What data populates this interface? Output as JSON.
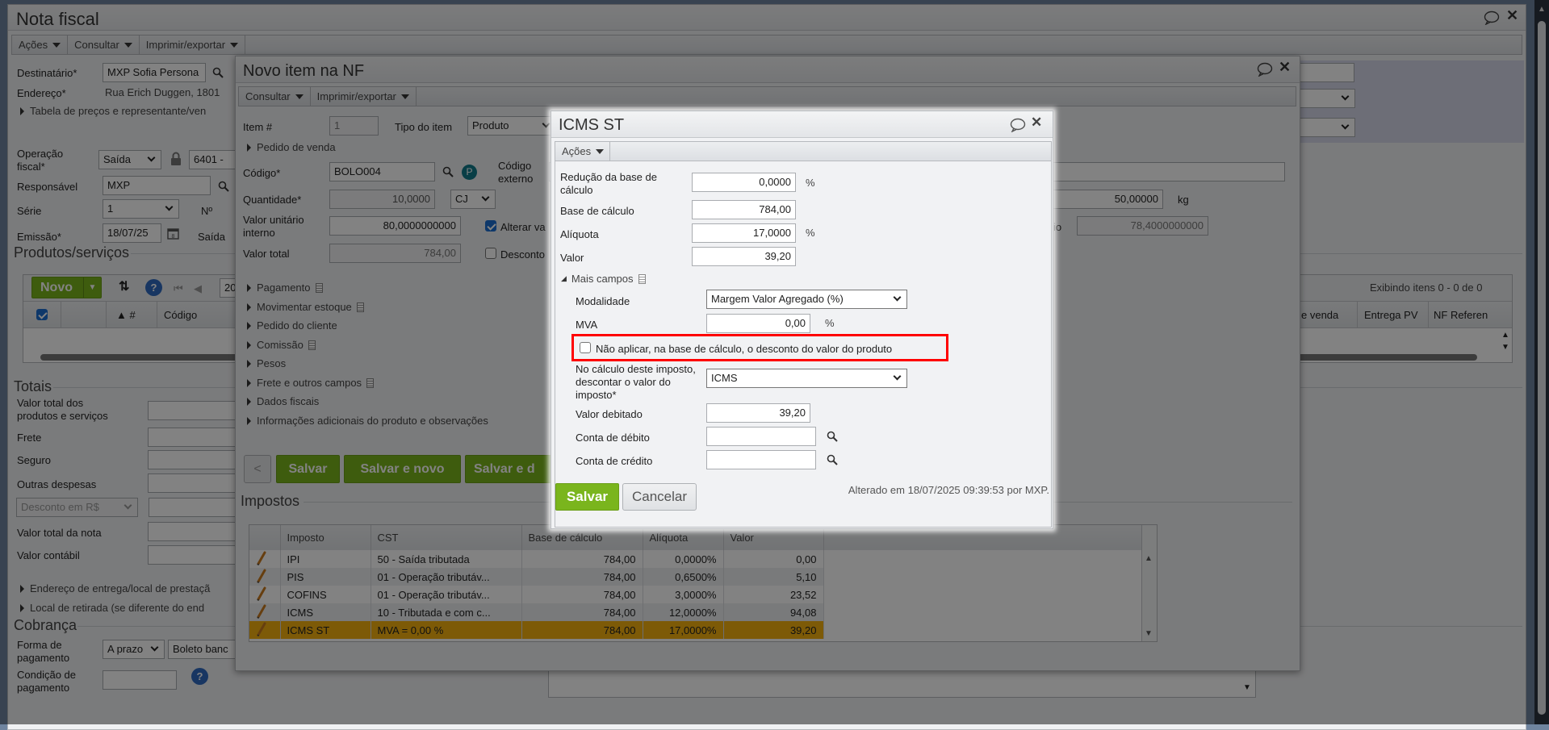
{
  "outer": {
    "title": "Nota fiscal",
    "menus": [
      "Ações",
      "Consultar",
      "Imprimir/exportar"
    ],
    "destinatario": {
      "label": "Destinatário*",
      "value": "MXP Sofia Persona"
    },
    "endereco": {
      "label": "Endereço*",
      "value": "Rua Erich Duggen, 1801"
    },
    "tabela_precos": "Tabela de preços e representante/ven",
    "operacao": {
      "label": "Operação fiscal*",
      "value": "Saída",
      "cfop": "6401 - "
    },
    "responsavel": {
      "label": "Responsável",
      "value": "MXP"
    },
    "serie": {
      "label": "Série",
      "value": "1"
    },
    "numero_label": "Nº",
    "emissao": {
      "label": "Emissão*",
      "value": "18/07/25"
    },
    "saida_label": "Saída",
    "produtos_title": "Produtos/serviços",
    "grid": {
      "novo": "Novo",
      "page": "20",
      "status": "Exibindo itens 0 - 0 de 0",
      "col_num": "▲ #",
      "col_codigo": "Código",
      "col_venda": "e venda",
      "col_entrega": "Entrega PV",
      "col_nf": "NF Referen"
    },
    "totais": {
      "title": "Totais",
      "fields": [
        "Valor total dos produtos e serviços",
        "Frete",
        "Seguro",
        "Outras despesas",
        "",
        "Valor total da nota",
        "Valor contábil"
      ],
      "desconto_select": "Desconto em R$"
    },
    "endereco_entrega": "Endereço de entrega/local de prestaçã",
    "local_retirada": "Local de retirada (se diferente do end",
    "cobranca": {
      "title": "Cobrança",
      "forma_label": "Forma de pagamento",
      "forma_value": "A prazo",
      "forma_tipo": "Boleto banc",
      "condicao_label": "Condição de pagamento"
    }
  },
  "item_window": {
    "title": "Novo item na NF",
    "menus": [
      "Consultar",
      "Imprimir/exportar"
    ],
    "item": {
      "label": "Item #",
      "value": "1"
    },
    "tipo": {
      "label": "Tipo do item",
      "value": "Produto"
    },
    "pedido_venda": "Pedido de venda",
    "codigo": {
      "label": "Código*",
      "value": "BOLO004"
    },
    "codigo_externo_label": "Código externo",
    "quantidade": {
      "label": "Quantidade*",
      "value": "10,0000",
      "unit": "CJ"
    },
    "valor_unitario": {
      "label": "Valor unitário interno",
      "value": "80,0000000000"
    },
    "alterar_label": "Alterar va",
    "alterar_checked": true,
    "valor_total": {
      "label": "Valor total",
      "value": "784,00"
    },
    "desconto_label": "Desconto",
    "desconto_checked": false,
    "peso": {
      "value": "50,00000",
      "unit": "kg"
    },
    "valor_frag_label": "io",
    "valor_frag_value": "78,4000000000",
    "sections": [
      {
        "label": "Pagamento",
        "doc": true
      },
      {
        "label": "Movimentar estoque",
        "doc": true
      },
      {
        "label": "Pedido do cliente",
        "doc": false
      },
      {
        "label": "Comissão",
        "doc": true
      },
      {
        "label": "Pesos",
        "doc": false
      },
      {
        "label": "Frete e outros campos",
        "doc": true
      },
      {
        "label": "Dados fiscais",
        "doc": false
      },
      {
        "label": "Informações adicionais do produto e observações",
        "doc": false
      }
    ],
    "buttons": {
      "prev": "<",
      "save": "Salvar",
      "save_new": "Salvar e novo",
      "save_dup": "Salvar e d"
    },
    "impostos_title": "Impostos"
  },
  "taxes": {
    "columns": [
      "Imposto",
      "CST",
      "Base de cálculo",
      "Alíquota",
      "Valor"
    ],
    "rows": [
      {
        "imposto": "IPI",
        "cst": "50 - Saída tributada",
        "base": "784,00",
        "aliquota": "0,0000%",
        "valor": "0,00"
      },
      {
        "imposto": "PIS",
        "cst": "01 - Operação tributáv...",
        "base": "784,00",
        "aliquota": "0,6500%",
        "valor": "5,10"
      },
      {
        "imposto": "COFINS",
        "cst": "01 - Operação tributáv...",
        "base": "784,00",
        "aliquota": "3,0000%",
        "valor": "23,52"
      },
      {
        "imposto": "ICMS",
        "cst": "10 - Tributada e com c...",
        "base": "784,00",
        "aliquota": "12,0000%",
        "valor": "94,08"
      },
      {
        "imposto": "ICMS ST",
        "cst": "MVA = 0,00 %",
        "base": "784,00",
        "aliquota": "17,0000%",
        "valor": "39,20",
        "selected": true
      }
    ],
    "selected_color": "#f5b10f"
  },
  "icms_st": {
    "title": "ICMS ST",
    "menu": "Ações",
    "reducao": {
      "label": "Redução da base de cálculo",
      "value": "0,0000",
      "unit": "%"
    },
    "base": {
      "label": "Base de cálculo",
      "value": "784,00"
    },
    "aliquota": {
      "label": "Alíquota",
      "value": "17,0000",
      "unit": "%"
    },
    "valor": {
      "label": "Valor",
      "value": "39,20"
    },
    "mais_campos": "Mais campos",
    "modalidade": {
      "label": "Modalidade",
      "value": "Margem Valor Agregado (%)"
    },
    "mva": {
      "label": "MVA",
      "value": "0,00",
      "unit": "%"
    },
    "nao_aplicar": {
      "label": "Não aplicar, na base de cálculo, o desconto do valor do produto",
      "checked": false
    },
    "descontar": {
      "label": "No cálculo deste imposto, descontar o valor do imposto*",
      "value": "ICMS"
    },
    "valor_debitado": {
      "label": "Valor debitado",
      "value": "39,20"
    },
    "conta_debito": {
      "label": "Conta de débito",
      "value": ""
    },
    "conta_credito": {
      "label": "Conta de crédito",
      "value": ""
    },
    "save": "Salvar",
    "cancel": "Cancelar",
    "changed": "Alterado em 18/07/2025 09:39:53 por MXP.",
    "highlight_color": "#ff0000",
    "accent_color": "#7ab51d"
  }
}
